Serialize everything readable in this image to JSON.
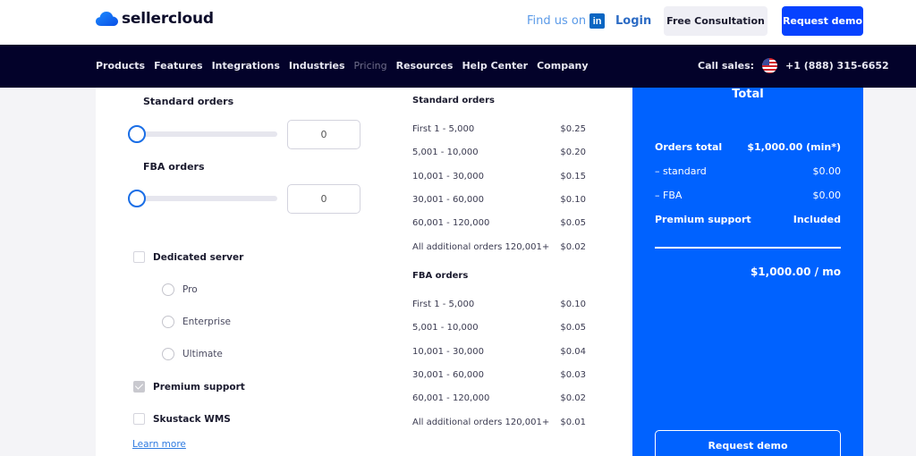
{
  "header": {
    "brand": "sellercloud",
    "find_us_label": "Find us on",
    "linkedin_icon": "in",
    "login_label": "Login",
    "consultation_label": "Free Consultation",
    "request_demo_label": "Request demo"
  },
  "nav": {
    "items": [
      {
        "label": "Products"
      },
      {
        "label": "Features"
      },
      {
        "label": "Integrations"
      },
      {
        "label": "Industries"
      },
      {
        "label": "Pricing"
      },
      {
        "label": "Resources"
      },
      {
        "label": "Help Center"
      },
      {
        "label": "Company"
      }
    ],
    "call_sales_label": "Call sales:",
    "phone": "+1 (888) 315-6652"
  },
  "calculator": {
    "standard_label": "Standard orders",
    "standard_value": "0",
    "standard_slider_fraction": 0,
    "fba_label": "FBA orders",
    "fba_value": "0",
    "fba_slider_fraction": 0,
    "options": {
      "dedicated_server": {
        "label": "Dedicated server",
        "checked": false
      },
      "tiers": [
        {
          "label": "Pro",
          "selected": false
        },
        {
          "label": "Enterprise",
          "selected": false
        },
        {
          "label": "Ultimate",
          "selected": false
        }
      ],
      "premium_support": {
        "label": "Premium support",
        "checked": true
      },
      "skustack": {
        "label": "Skustack WMS",
        "checked": false
      }
    },
    "learn_more_label": "Learn more"
  },
  "pricing": {
    "standard": {
      "title": "Standard orders",
      "rows": [
        {
          "range": "First 1 - 5,000",
          "price": "$0.25"
        },
        {
          "range": "5,001 - 10,000",
          "price": "$0.20"
        },
        {
          "range": "10,001 - 30,000",
          "price": "$0.15"
        },
        {
          "range": "30,001 - 60,000",
          "price": "$0.10"
        },
        {
          "range": "60,001 - 120,000",
          "price": "$0.05"
        },
        {
          "range": "All additional orders 120,001+",
          "price": "$0.02"
        }
      ]
    },
    "fba": {
      "title": "FBA orders",
      "rows": [
        {
          "range": "First 1 - 5,000",
          "price": "$0.10"
        },
        {
          "range": "5,001 - 10,000",
          "price": "$0.05"
        },
        {
          "range": "10,001 - 30,000",
          "price": "$0.04"
        },
        {
          "range": "30,001 - 60,000",
          "price": "$0.03"
        },
        {
          "range": "60,001 - 120,000",
          "price": "$0.02"
        },
        {
          "range": "All additional orders 120,001+",
          "price": "$0.01"
        }
      ]
    }
  },
  "total": {
    "title": "Total",
    "orders_total_label": "Orders total",
    "orders_total_value": "$1,000.00 (min*)",
    "standard_label": "– standard",
    "standard_value": "$0.00",
    "fba_label": "– FBA",
    "fba_value": "$0.00",
    "premium_label": "Premium support",
    "premium_value": "Included",
    "grand_total": "$1,000.00 / mo",
    "request_demo_label": "Request demo"
  },
  "colors": {
    "brand_blue": "#0062ff",
    "nav_bg": "#03022a",
    "cta_blue": "#0642ff"
  }
}
